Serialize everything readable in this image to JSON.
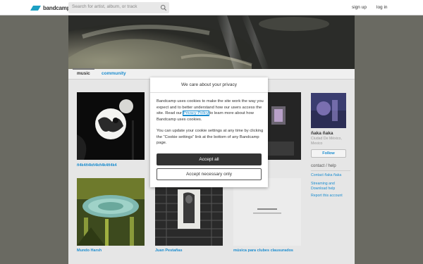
{
  "header": {
    "logo_text": "bandcamp",
    "search_placeholder": "Search for artist, album, or track",
    "signup": "sign up",
    "login": "log in"
  },
  "tabs": [
    "music",
    "community"
  ],
  "albums": [
    {
      "title": "ñ4k4ñ4kñ4kñ4k4ñ4k4"
    },
    {
      "title": "Mundo Harsh"
    },
    {
      "title": "Juan Pestañas"
    },
    {
      "title": "música para clubes clausurados"
    }
  ],
  "artist": {
    "name": "ñaka ñaka",
    "location": "Ciudad De México, Mexico",
    "follow": "Follow",
    "contact_heading": "contact / help",
    "links": [
      "Contact ñaka ñaka",
      "Streaming and Download help",
      "Report this account"
    ]
  },
  "cookie_modal": {
    "title": "We care about your privacy",
    "p1_before": "Bandcamp uses cookies to make the site work the way you expect and to better understand how our users access the site. Read our ",
    "p1_link": "Privacy Policy",
    "p1_after": " to learn more about how Bandcamp uses cookies.",
    "p2": "You can update your cookie settings at any time by clicking the “Cookie settings” link at the bottom of any Bandcamp page.",
    "accept_all": "Accept all",
    "accept_necessary": "Accept necessary only"
  },
  "colors": {
    "accent": "#1a8ccf",
    "logo": "#1da0c3",
    "primary_button": "#333333"
  }
}
